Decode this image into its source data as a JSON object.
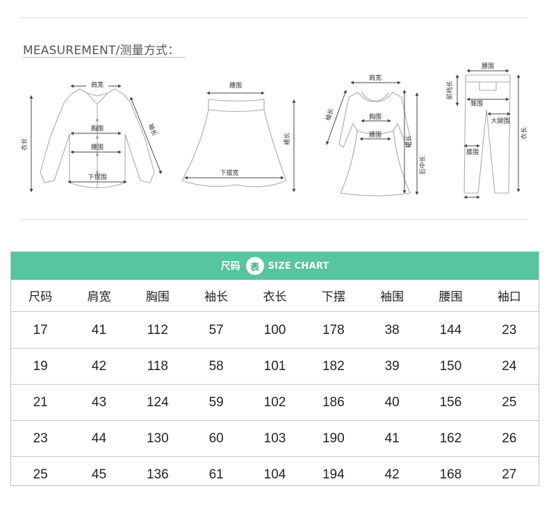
{
  "measurement": {
    "heading": "MEASUREMENT/测量方式：",
    "shirt": {
      "shoulder": "肩宽",
      "chest": "胸围",
      "waist": "腰围",
      "hem": "下摆围",
      "length": "衣长",
      "sleeve": "袖长"
    },
    "skirt": {
      "waist": "腰围",
      "hem": "下摆宽",
      "length": "裙长"
    },
    "dress": {
      "shoulder": "肩宽",
      "sleeve": "袖长",
      "chest": "胸围",
      "waist": "腰围",
      "skirt_length": "裙长",
      "back_length": "后中长"
    },
    "pants": {
      "waist": "腰围",
      "front_rise": "前裆长",
      "hip": "臀围",
      "thigh": "大腿围",
      "knee": "膝围",
      "length": "衣长"
    }
  },
  "size_chart": {
    "banner_left": "尺码",
    "banner_circle": "表",
    "banner_right": "SIZE CHART",
    "headers": [
      "尺码",
      "肩宽",
      "胸围",
      "袖长",
      "衣长",
      "下摆",
      "袖围",
      "腰围",
      "袖口"
    ],
    "rows": [
      [
        "17",
        "41",
        "112",
        "57",
        "100",
        "178",
        "38",
        "144",
        "23"
      ],
      [
        "19",
        "42",
        "118",
        "58",
        "101",
        "182",
        "39",
        "150",
        "24"
      ],
      [
        "21",
        "43",
        "124",
        "59",
        "102",
        "186",
        "40",
        "156",
        "25"
      ],
      [
        "23",
        "44",
        "130",
        "60",
        "103",
        "190",
        "41",
        "162",
        "26"
      ],
      [
        "25",
        "45",
        "136",
        "61",
        "104",
        "194",
        "42",
        "168",
        "27"
      ]
    ]
  }
}
